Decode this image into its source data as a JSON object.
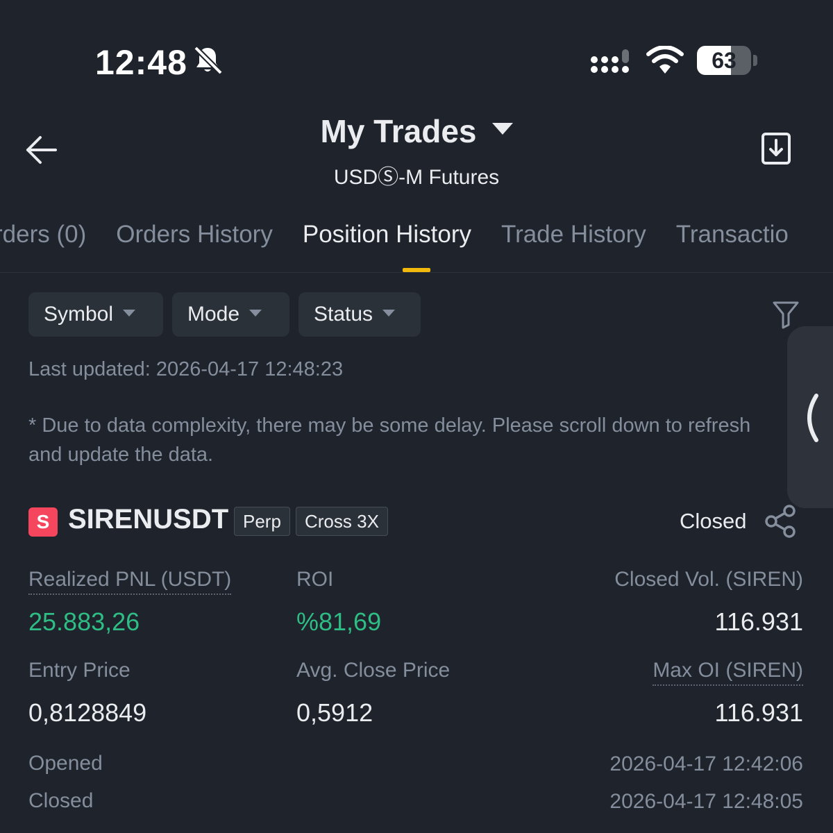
{
  "status_bar": {
    "time": "12:48",
    "battery": "63",
    "battery_level": 0.63
  },
  "header": {
    "title": "My Trades",
    "subtitle": "USDⓈ-M Futures"
  },
  "tabs": [
    {
      "label": "rders (0)",
      "active": false
    },
    {
      "label": "Orders History",
      "active": false
    },
    {
      "label": "Position History",
      "active": true
    },
    {
      "label": "Trade History",
      "active": false
    },
    {
      "label": "Transactio",
      "active": false
    }
  ],
  "filters": {
    "symbol": "Symbol",
    "mode": "Mode",
    "status": "Status"
  },
  "last_updated": "Last updated: 2026-04-17 12:48:23",
  "notice": "* Due to data complexity, there may be some delay. Please scroll down to refresh and update the data.",
  "position": {
    "badge": "S",
    "symbol": "SIRENUSDT",
    "tags": [
      "Perp",
      "Cross 3X"
    ],
    "status": "Closed",
    "realized_pnl_label": "Realized PNL (USDT)",
    "realized_pnl": "25.883,26",
    "roi_label": "ROI",
    "roi": "%81,69",
    "closed_vol_label": "Closed Vol. (SIREN)",
    "closed_vol": "116.931",
    "entry_price_label": "Entry Price",
    "entry_price": "0,8128849",
    "avg_close_label": "Avg. Close Price",
    "avg_close": "0,5912",
    "max_oi_label": "Max OI (SIREN)",
    "max_oi": "116.931",
    "opened_label": "Opened",
    "opened": "2026-04-17 12:42:06",
    "closed_label": "Closed",
    "closed": "2026-04-17 12:48:05"
  },
  "colors": {
    "background": "#1f232b",
    "accent": "#f0b90b",
    "positive": "#2ebd85",
    "badge": "#f6465d"
  }
}
